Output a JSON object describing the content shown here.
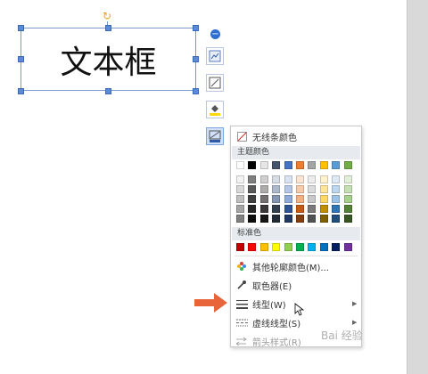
{
  "textbox": {
    "text": "文本框"
  },
  "menu": {
    "no_line_label": "无线条颜色",
    "theme_header": "主题颜色",
    "standard_header": "标准色",
    "more_colors_label": "其他轮廓颜色(M)...",
    "eyedropper_label": "取色器(E)",
    "line_type_label": "线型(W)",
    "dash_type_label": "虚线线型(S)",
    "arrow_style_label": "箭头样式(R)",
    "theme_top_row": [
      "#ffffff",
      "#000000",
      "#e7e6e6",
      "#44546a",
      "#4472c4",
      "#ed7d31",
      "#a5a5a5",
      "#ffc000",
      "#5b9bd5",
      "#70ad47"
    ],
    "theme_shades": [
      [
        "#f2f2f2",
        "#7f7f7f",
        "#d0cece",
        "#d6dce4",
        "#d9e2f3",
        "#fbe5d5",
        "#ededed",
        "#fff2cc",
        "#deeaf6",
        "#e2efd9"
      ],
      [
        "#d8d8d8",
        "#595959",
        "#aeabab",
        "#adb9ca",
        "#b4c6e7",
        "#f7cbac",
        "#dbdbdb",
        "#fee599",
        "#bdd7ee",
        "#c5e0b3"
      ],
      [
        "#bfbfbf",
        "#3f3f3f",
        "#757070",
        "#8496b0",
        "#8eaadb",
        "#f4b183",
        "#c9c9c9",
        "#ffd966",
        "#9cc3e5",
        "#a8d08d"
      ],
      [
        "#a5a5a5",
        "#262626",
        "#3a3838",
        "#323f4f",
        "#2f5496",
        "#c55a11",
        "#7b7b7b",
        "#bf8f00",
        "#2e75b5",
        "#538135"
      ],
      [
        "#7f7f7f",
        "#0c0c0c",
        "#171616",
        "#222a35",
        "#1f3864",
        "#833c0b",
        "#525252",
        "#7f6000",
        "#1e4e79",
        "#375623"
      ]
    ],
    "standard_colors": [
      "#c00000",
      "#ff0000",
      "#ffc000",
      "#ffff00",
      "#92d050",
      "#00b050",
      "#00b0f0",
      "#0070c0",
      "#002060",
      "#7030a0"
    ]
  },
  "watermark": "Bai 经验"
}
